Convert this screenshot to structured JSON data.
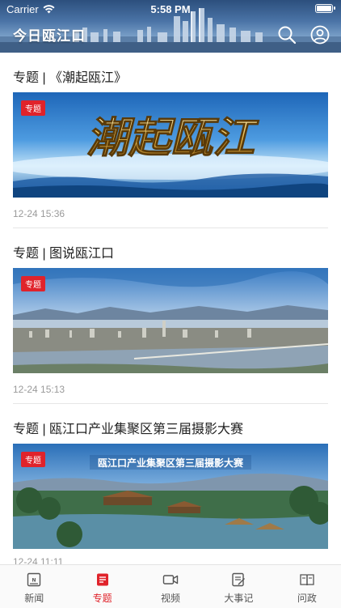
{
  "status_bar": {
    "carrier": "Carrier",
    "time": "5:58 PM"
  },
  "header": {
    "title": "今日瓯江口",
    "search_icon": "search-icon",
    "profile_icon": "profile-icon"
  },
  "feed": [
    {
      "title": "专题 | 《潮起瓯江》",
      "tag": "专题",
      "image_text": "潮起瓯江",
      "time": "12-24 15:36"
    },
    {
      "title": "专题 | 图说瓯江口",
      "tag": "专题",
      "time": "12-24 15:13"
    },
    {
      "title": "专题 | 瓯江口产业集聚区第三届摄影大赛",
      "tag": "专题",
      "image_text": "瓯江口产业集聚区第三届摄影大赛",
      "time": "12-24 11:11"
    }
  ],
  "tabbar": {
    "accent_color": "#e0232b",
    "items": [
      {
        "label": "新闻",
        "icon": "news-icon",
        "active": false
      },
      {
        "label": "专题",
        "icon": "topic-icon",
        "active": true
      },
      {
        "label": "视频",
        "icon": "video-icon",
        "active": false
      },
      {
        "label": "大事记",
        "icon": "chronicle-icon",
        "active": false
      },
      {
        "label": "问政",
        "icon": "inquiry-icon",
        "active": false
      }
    ]
  }
}
